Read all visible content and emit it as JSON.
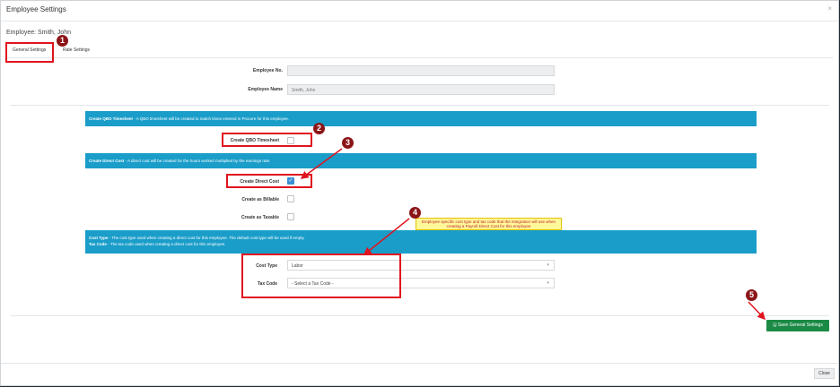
{
  "modal": {
    "title": "Employee Settings",
    "close_glyph": "×",
    "employee_line": "Employee: Smith, John",
    "tabs": [
      {
        "label": "General Settings",
        "active": true
      },
      {
        "label": "Rate Settings",
        "active": false
      }
    ]
  },
  "fields": {
    "employee_no_label": "Employee No.",
    "employee_no_value": "",
    "employee_name_label": "Employee Name",
    "employee_name_value": "Smith, John"
  },
  "qbo": {
    "band_title": "Create QBO Timesheet",
    "band_text": " - A QBO timesheet will be created to match times entered in Procore for this employee.",
    "checkbox_label": "Create QBO Timesheet",
    "checked": false
  },
  "direct_cost": {
    "band_title": "Create Direct Cost",
    "band_text": " - A direct cost will be created for the hours worked multiplied by the earnings rate.",
    "create_label": "Create Direct Cost",
    "create_checked": true,
    "billable_label": "Create as Billable",
    "billable_checked": false,
    "taxable_label": "Create as Taxable",
    "taxable_checked": false
  },
  "cost_type": {
    "band_title_1": "Cost Type",
    "band_text_1": " - The cost type used when creating a direct cost for this employee. The default cost type will be used if empty.",
    "band_title_2": "Tax Code",
    "band_text_2": " - The tax code used when creating a direct cost for this employee.",
    "cost_type_label": "Cost Type",
    "cost_type_value": "Labor",
    "tax_code_label": "Tax Code",
    "tax_code_value": "- Select a Tax Code -",
    "caret": "▾"
  },
  "callout": "Employee specific cost type and tax code that the integration will use when creating a Payroll Direct Cost for this employee",
  "markers": [
    "1",
    "2",
    "3",
    "4",
    "5"
  ],
  "buttons": {
    "save_icon": "🖫",
    "save_label": "Save General Settings",
    "close_label": "Close"
  },
  "colors": {
    "band": "#1a9dc9",
    "save": "#1b8a45",
    "annotation_red": "#e0141e",
    "marker": "#8b1417"
  }
}
